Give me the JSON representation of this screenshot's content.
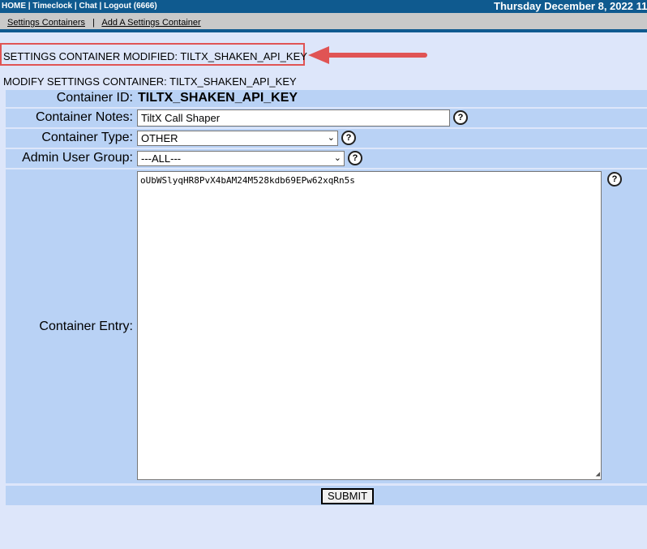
{
  "topbar": {
    "home": "HOME",
    "timeclock": "Timeclock",
    "chat": "Chat",
    "logout": "Logout (6666)",
    "separator": "|",
    "date": "Thursday December 8, 2022 11"
  },
  "subnav": {
    "settings_containers": "Settings Containers",
    "add_container": "Add A Settings Container",
    "separator": "|"
  },
  "notice": {
    "text": "SETTINGS CONTAINER MODIFIED: TILTX_SHAKEN_API_KEY"
  },
  "page_title": "MODIFY SETTINGS CONTAINER: TILTX_SHAKEN_API_KEY",
  "form": {
    "container_id_label": "Container ID:",
    "container_id_value": "TILTX_SHAKEN_API_KEY",
    "notes_label": "Container Notes:",
    "notes_value": "TiltX Call Shaper",
    "type_label": "Container Type:",
    "type_value": "OTHER",
    "group_label": "Admin User Group:",
    "group_value": "---ALL---",
    "entry_label": "Container Entry:",
    "entry_value": "oUbWSlyqHR8PvX4bAM24M528kdb69EPw62xqRn5s",
    "help_symbol": "?",
    "submit_label": "SUBMIT"
  },
  "colors": {
    "header_bg": "#0f5a8f",
    "page_bg": "#dde6fa",
    "row_bg": "#b9d2f5",
    "annotation_red": "#e05454"
  }
}
